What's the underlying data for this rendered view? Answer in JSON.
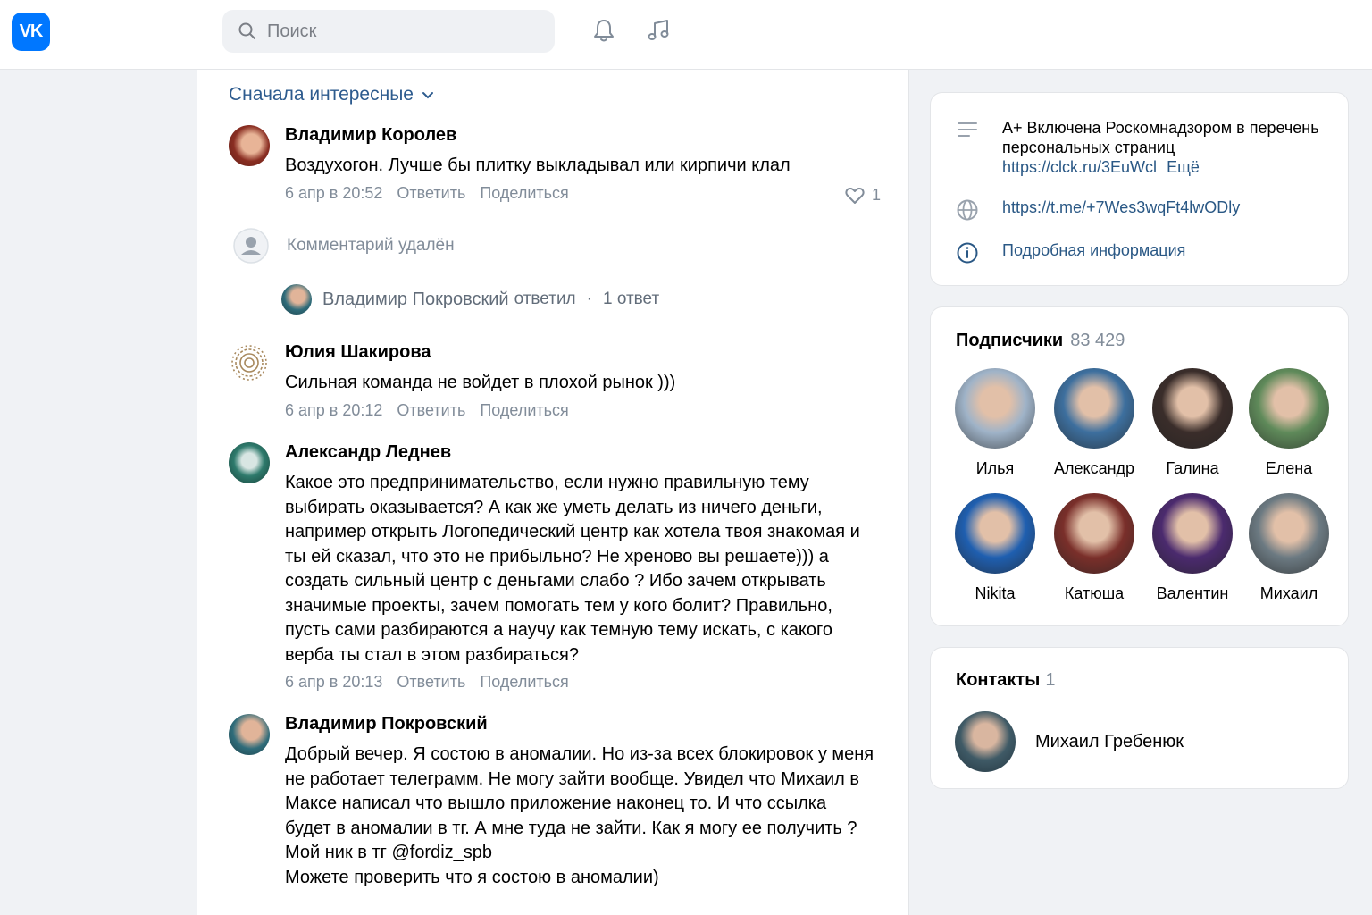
{
  "header": {
    "logo": "VK",
    "search_placeholder": "Поиск",
    "icons": [
      "bell-icon",
      "music-icon"
    ]
  },
  "feed": {
    "sort_label": "Сначала интересные",
    "comments": [
      {
        "name": "Владимир Королев",
        "text": "Воздухогон. Лучше бы плитку выкладывал или кирпичи клал",
        "date": "6 апр в 20:52",
        "reply": "Ответить",
        "share": "Поделиться",
        "likes": "1"
      },
      {
        "name": "Юлия Шакирова",
        "text": "Сильная команда не войдет в плохой рынок )))",
        "date": "6 апр в 20:12",
        "reply": "Ответить",
        "share": "Поделиться"
      },
      {
        "name": "Александр Леднев",
        "text": "Какое это предпринимательство, если нужно правильную тему выбирать оказывается? А как же уметь делать из ничего деньги, например открыть Логопедический центр как хотела твоя знакомая и ты ей сказал, что это не прибыльно? Не хреново вы решаете))) а создать сильный центр с деньгами слабо ? Ибо зачем открывать значимые проекты, зачем помогать тем у кого болит? Правильно, пусть сами разбираются а научу как темную тему искать, с какого верба ты стал в этом разбираться?",
        "date": "6 апр в 20:13",
        "reply": "Ответить",
        "share": "Поделиться"
      },
      {
        "name": "Владимир Покровский",
        "text": "Добрый вечер. Я состою в аномалии. Но из-за всех блокировок у меня не работает телеграмм. Не могу зайти вообще. Увидел что Михаил в Максе написал что вышло приложение наконец то. И что ссылка будет в аномалии в тг. А мне туда не зайти. Как я могу ее получить ? Мой ник в тг @fordiz_spb",
        "text2": "Можете проверить что я состою в аномалии)"
      }
    ],
    "deleted_label": "Комментарий удалён",
    "reply_info": {
      "name": "Владимир Покровский",
      "action": "ответил",
      "separator": "·",
      "count": "1 ответ"
    }
  },
  "sidebar": {
    "info": {
      "description_line1": "A+ Включена Роскомнадзором в перечень",
      "description_line2": "персональных страниц",
      "description_link": "https://clck.ru/3EuWcl",
      "more": "Ещё",
      "website": "https://t.me/+7Wes3wqFt4lwODly",
      "details": "Подробная информация"
    },
    "subscribers": {
      "title": "Подписчики",
      "count": "83 429",
      "people": [
        {
          "name": "Илья",
          "color": "#9fb3c8"
        },
        {
          "name": "Александр",
          "color": "#3d6f9e"
        },
        {
          "name": "Галина",
          "color": "#3a2d2a"
        },
        {
          "name": "Елена",
          "color": "#5f8a5a"
        },
        {
          "name": "Nikita",
          "color": "#1f5fb0"
        },
        {
          "name": "Катюша",
          "color": "#7a2f2a"
        },
        {
          "name": "Валентин",
          "color": "#4b2a6e"
        },
        {
          "name": "Михаил",
          "color": "#6c7a82"
        }
      ]
    },
    "contacts": {
      "title": "Контакты",
      "count": "1",
      "person": "Михаил Гребенюк"
    }
  },
  "colors": {
    "accent": "#0077ff",
    "link": "#2a5885",
    "secondary": "#818c99"
  }
}
